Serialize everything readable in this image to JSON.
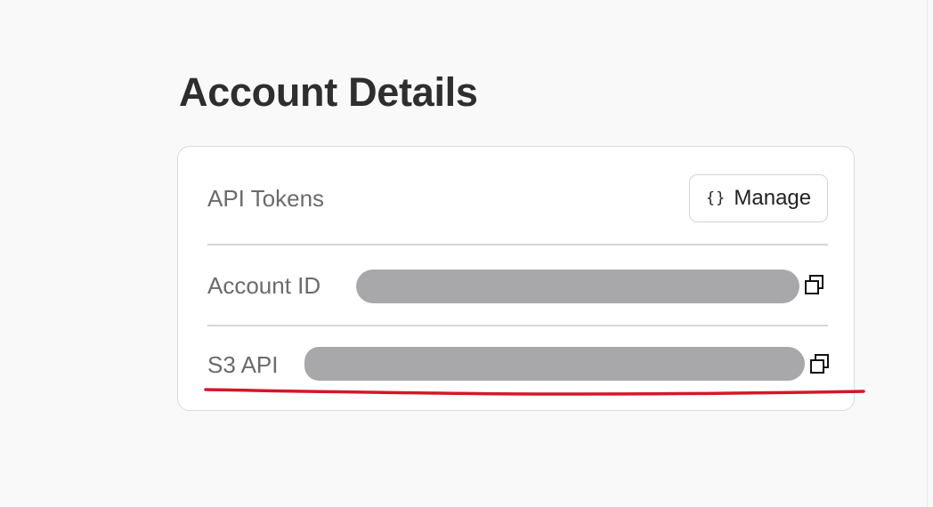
{
  "page": {
    "title": "Account Details"
  },
  "card": {
    "api_tokens": {
      "label": "API Tokens",
      "button": {
        "icon": "braces-icon",
        "icon_glyph": "{}",
        "label": "Manage"
      }
    },
    "account_id": {
      "label": "Account ID",
      "value_state": "redacted",
      "copy_icon": "copy-icon"
    },
    "s3_api": {
      "label": "S3 API",
      "value_state": "redacted",
      "copy_icon": "copy-icon"
    }
  },
  "annotation": {
    "underline_color": "#d4172a"
  },
  "colors": {
    "background": "#f9f9f9",
    "card": "#ffffff",
    "redaction": "#a8a8ab",
    "text_label": "#6b6b6b",
    "title": "#2e2e2e"
  }
}
